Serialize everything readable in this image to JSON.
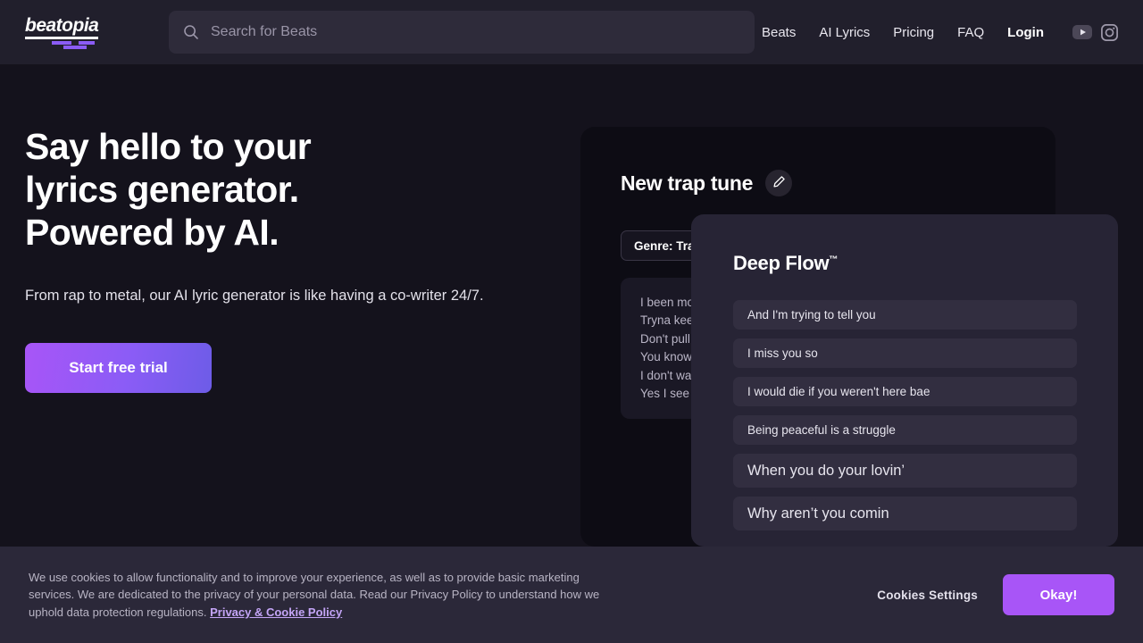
{
  "brand": {
    "name": "beatopia"
  },
  "header": {
    "search": {
      "placeholder": "Search for Beats",
      "value": "",
      "icon": "search-icon"
    },
    "nav": [
      {
        "label": "Beats"
      },
      {
        "label": "AI Lyrics"
      },
      {
        "label": "Pricing"
      },
      {
        "label": "FAQ"
      },
      {
        "label": "Login"
      }
    ],
    "social": [
      {
        "name": "youtube-icon"
      },
      {
        "name": "instagram-icon"
      }
    ]
  },
  "hero": {
    "heading_line1": "Say hello to your",
    "heading_line2": "lyrics generator.",
    "heading_line3": "Powered by AI.",
    "subtitle": "From rap to metal, our AI lyric generator is like having a co-writer 24/7.",
    "cta_label": "Start free trial"
  },
  "tune_card": {
    "title": "New trap tune",
    "edit_icon": "pencil-icon",
    "genre_chip": "Genre: Trap",
    "lyrics": [
      "I been mo",
      "Tryna kee",
      "Don't pull",
      "You know",
      "I don't wa",
      "Yes I see"
    ]
  },
  "flow_panel": {
    "title": "Deep Flow",
    "title_mark": "™",
    "items": [
      {
        "text": "And I'm trying to tell you",
        "size": "sm"
      },
      {
        "text": "I miss you so",
        "size": "sm"
      },
      {
        "text": "I would die if you weren't here bae",
        "size": "sm"
      },
      {
        "text": "Being peaceful is a struggle",
        "size": "sm"
      },
      {
        "text": "When you do your lovin’",
        "size": "lg"
      },
      {
        "text": "Why aren’t you comin",
        "size": "lg"
      }
    ]
  },
  "cookie_banner": {
    "text": "We use cookies to allow functionality and to improve your experience, as well as to provide basic marketing services. We are dedicated to the privacy of your personal data. Read our Privacy Policy to understand how we uphold data protection regulations.",
    "link_label": "Privacy & Cookie Policy",
    "settings_label": "Cookies Settings",
    "accept_label": "Okay!"
  },
  "colors": {
    "page_bg": "#14121c",
    "header_bg": "#211f2c",
    "card_bg": "#0d0c14",
    "panel_bg": "#272435",
    "accent_purple": "#a855f7",
    "accent_violet": "#8b5cf6",
    "cookie_bg": "#2b2839"
  }
}
